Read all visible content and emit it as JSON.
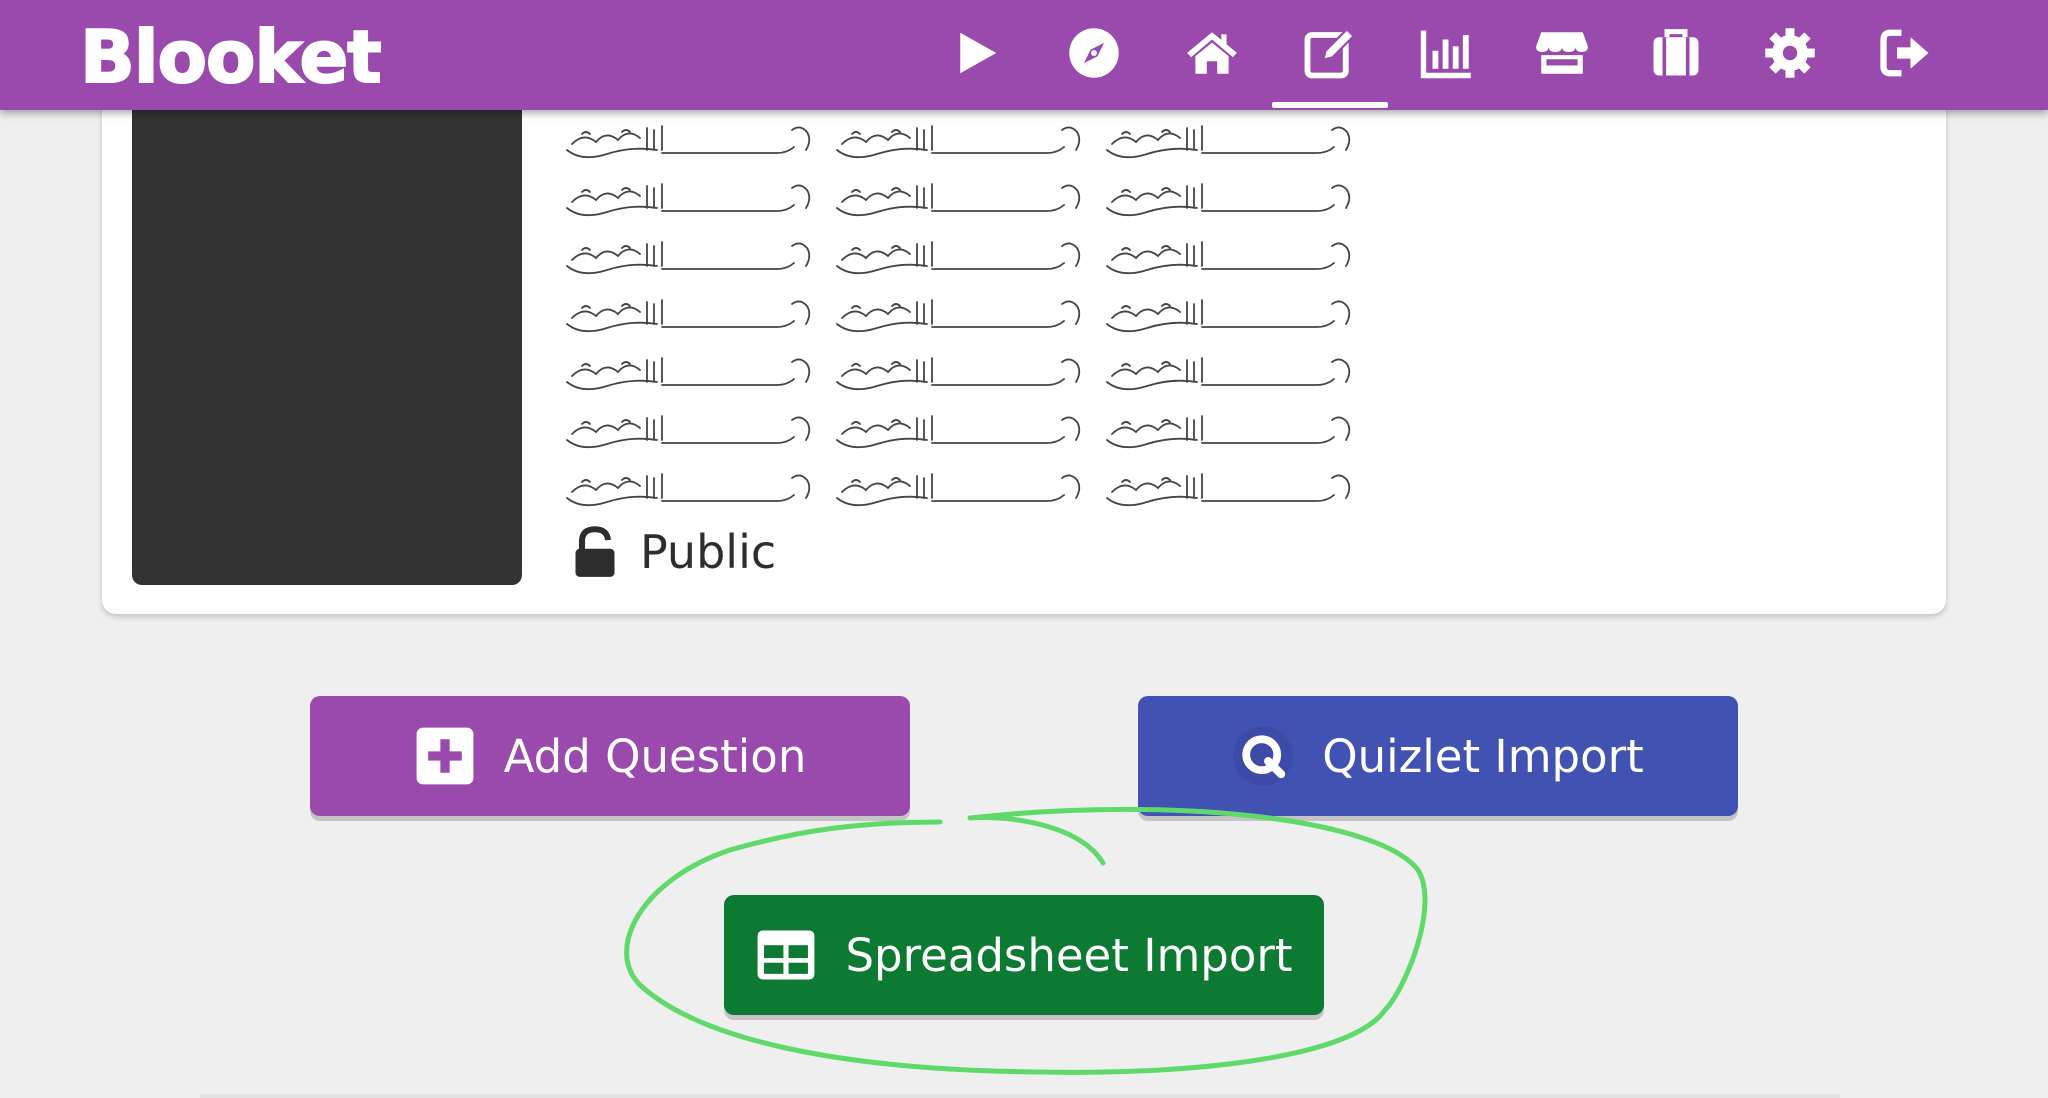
{
  "app": {
    "title": "Blooket"
  },
  "nav": {
    "items": [
      {
        "icon": "play-icon"
      },
      {
        "icon": "compass-icon"
      },
      {
        "icon": "home-icon"
      },
      {
        "icon": "edit-icon",
        "active": true
      },
      {
        "icon": "stats-icon"
      },
      {
        "icon": "market-icon"
      },
      {
        "icon": "blooks-icon"
      },
      {
        "icon": "settings-icon"
      },
      {
        "icon": "logout-icon"
      }
    ]
  },
  "set": {
    "visibility": "Public"
  },
  "actions": {
    "add_question": "Add Question",
    "quizlet_import": "Quizlet Import",
    "spreadsheet_import": "Spreadsheet Import"
  },
  "colors": {
    "brand_purple": "#9a4aad",
    "quizlet_blue": "#4252b2",
    "sheet_green": "#0c7a33",
    "highlight_green": "#5fd96a"
  }
}
